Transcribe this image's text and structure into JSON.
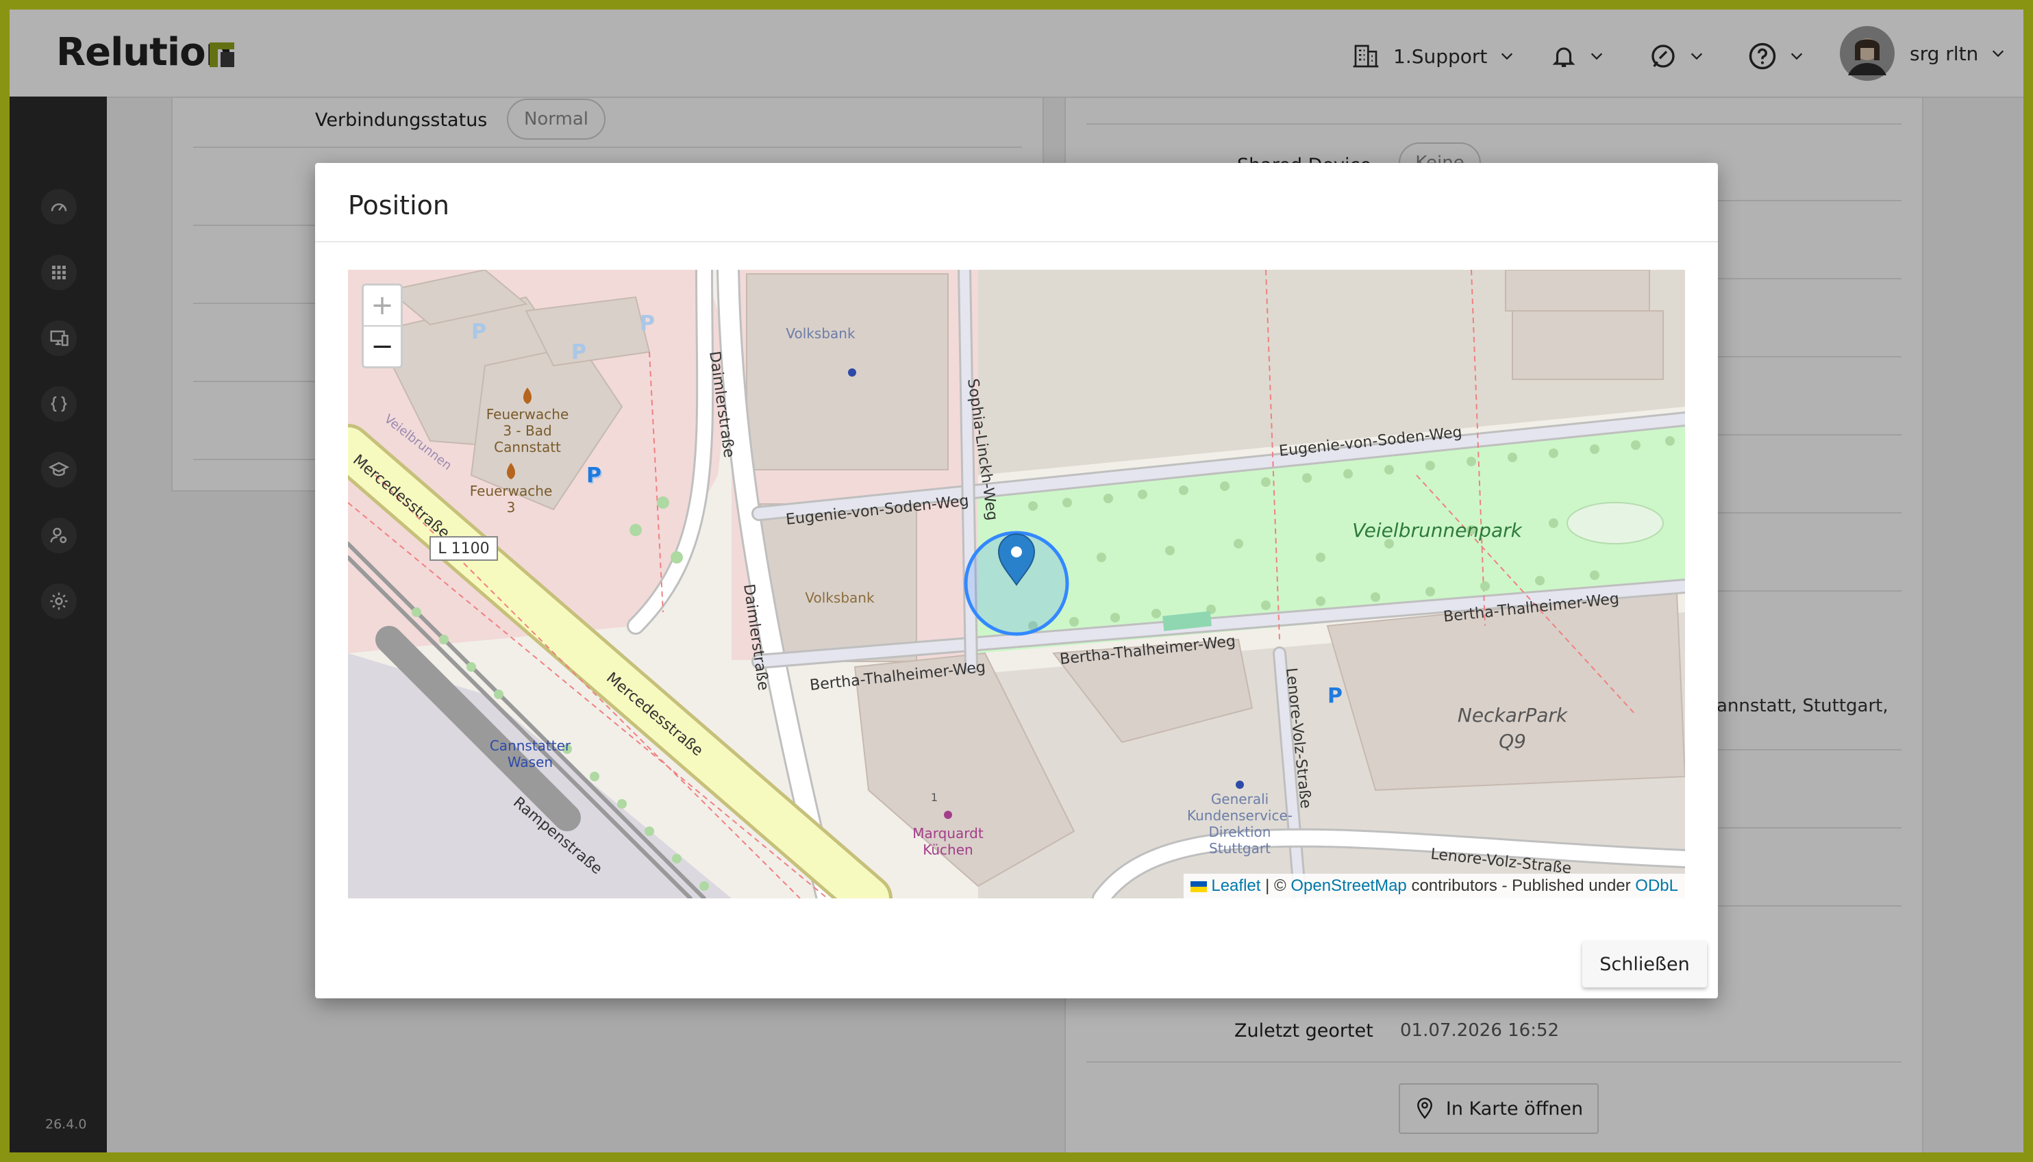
{
  "app": {
    "name": "Relution",
    "version": "26.4.0"
  },
  "header": {
    "organization": "1.Support",
    "user_name": "srg rltn"
  },
  "sidebar": {
    "items": [
      {
        "icon": "dashboard-icon"
      },
      {
        "icon": "apps-grid-icon"
      },
      {
        "icon": "devices-icon"
      },
      {
        "icon": "braces-icon"
      },
      {
        "icon": "education-icon"
      },
      {
        "icon": "users-settings-icon"
      },
      {
        "icon": "gear-icon"
      }
    ]
  },
  "background": {
    "connection_status_label": "Verbindungsstatus",
    "connection_status_value": "Normal",
    "shared_device_label": "Shared Device",
    "shared_device_value": "Keine",
    "address_fragment": "annstatt, Stuttgart,",
    "last_located_label": "Zuletzt geortet",
    "last_located_value": "01.07.2026 16:52",
    "open_map_label": "In Karte öffnen"
  },
  "modal": {
    "title": "Position",
    "close_label": "Schließen",
    "map": {
      "zoom_in": "+",
      "zoom_out": "−",
      "attribution_leaflet": "Leaflet",
      "attribution_sep": " | © ",
      "attribution_osm": "OpenStreetMap",
      "attribution_mid": " contributors - Published under ",
      "attribution_odbl": "ODbL",
      "labels": {
        "volksbank1": "Volksbank",
        "volksbank2": "Volksbank",
        "sophia": "Sophia-Linckh-Weg",
        "eugenie_left": "Eugenie-von-Soden-Weg",
        "eugenie_right": "Eugenie-von-Soden-Weg",
        "veielbrunnenpark": "Veielbrunnenpark",
        "bertha_left": "Bertha-Thalheimer-Weg",
        "bertha_mid": "Bertha-Thalheimer-Weg",
        "bertha_right": "Bertha-Thalheimer-Weg",
        "daimler1": "Daimlerstraße",
        "daimler2": "Daimlerstraße",
        "feuerwache_bad_1": "Feuerwache",
        "feuerwache_bad_2": "3 - Bad",
        "feuerwache_bad_3": "Cannstatt",
        "feuerwache3_1": "Feuerwache",
        "feuerwache3_2": "3",
        "veielbrunnen": "Veielbrunnen",
        "mercedes1": "Mercedesstraße",
        "mercedes2": "Mercedesstraße",
        "l1100": "L 1100",
        "cannstatter_1": "Cannstatter",
        "cannstatter_2": "Wasen",
        "rampen": "Rampenstraße",
        "marquardt_1": "Marquardt",
        "marquardt_2": "Küchen",
        "marquardt_num": "1",
        "lenore_volz_v": "Lenore-Volz-Straße",
        "lenore_volz_h": "Lenore-Volz-Straße",
        "generali_1": "Generali",
        "generali_2": "Kundenservice-",
        "generali_3": "Direktion",
        "generali_4": "Stuttgart",
        "neckarpark_1": "NeckarPark",
        "neckarpark_2": "Q9",
        "parking": "P"
      }
    }
  }
}
